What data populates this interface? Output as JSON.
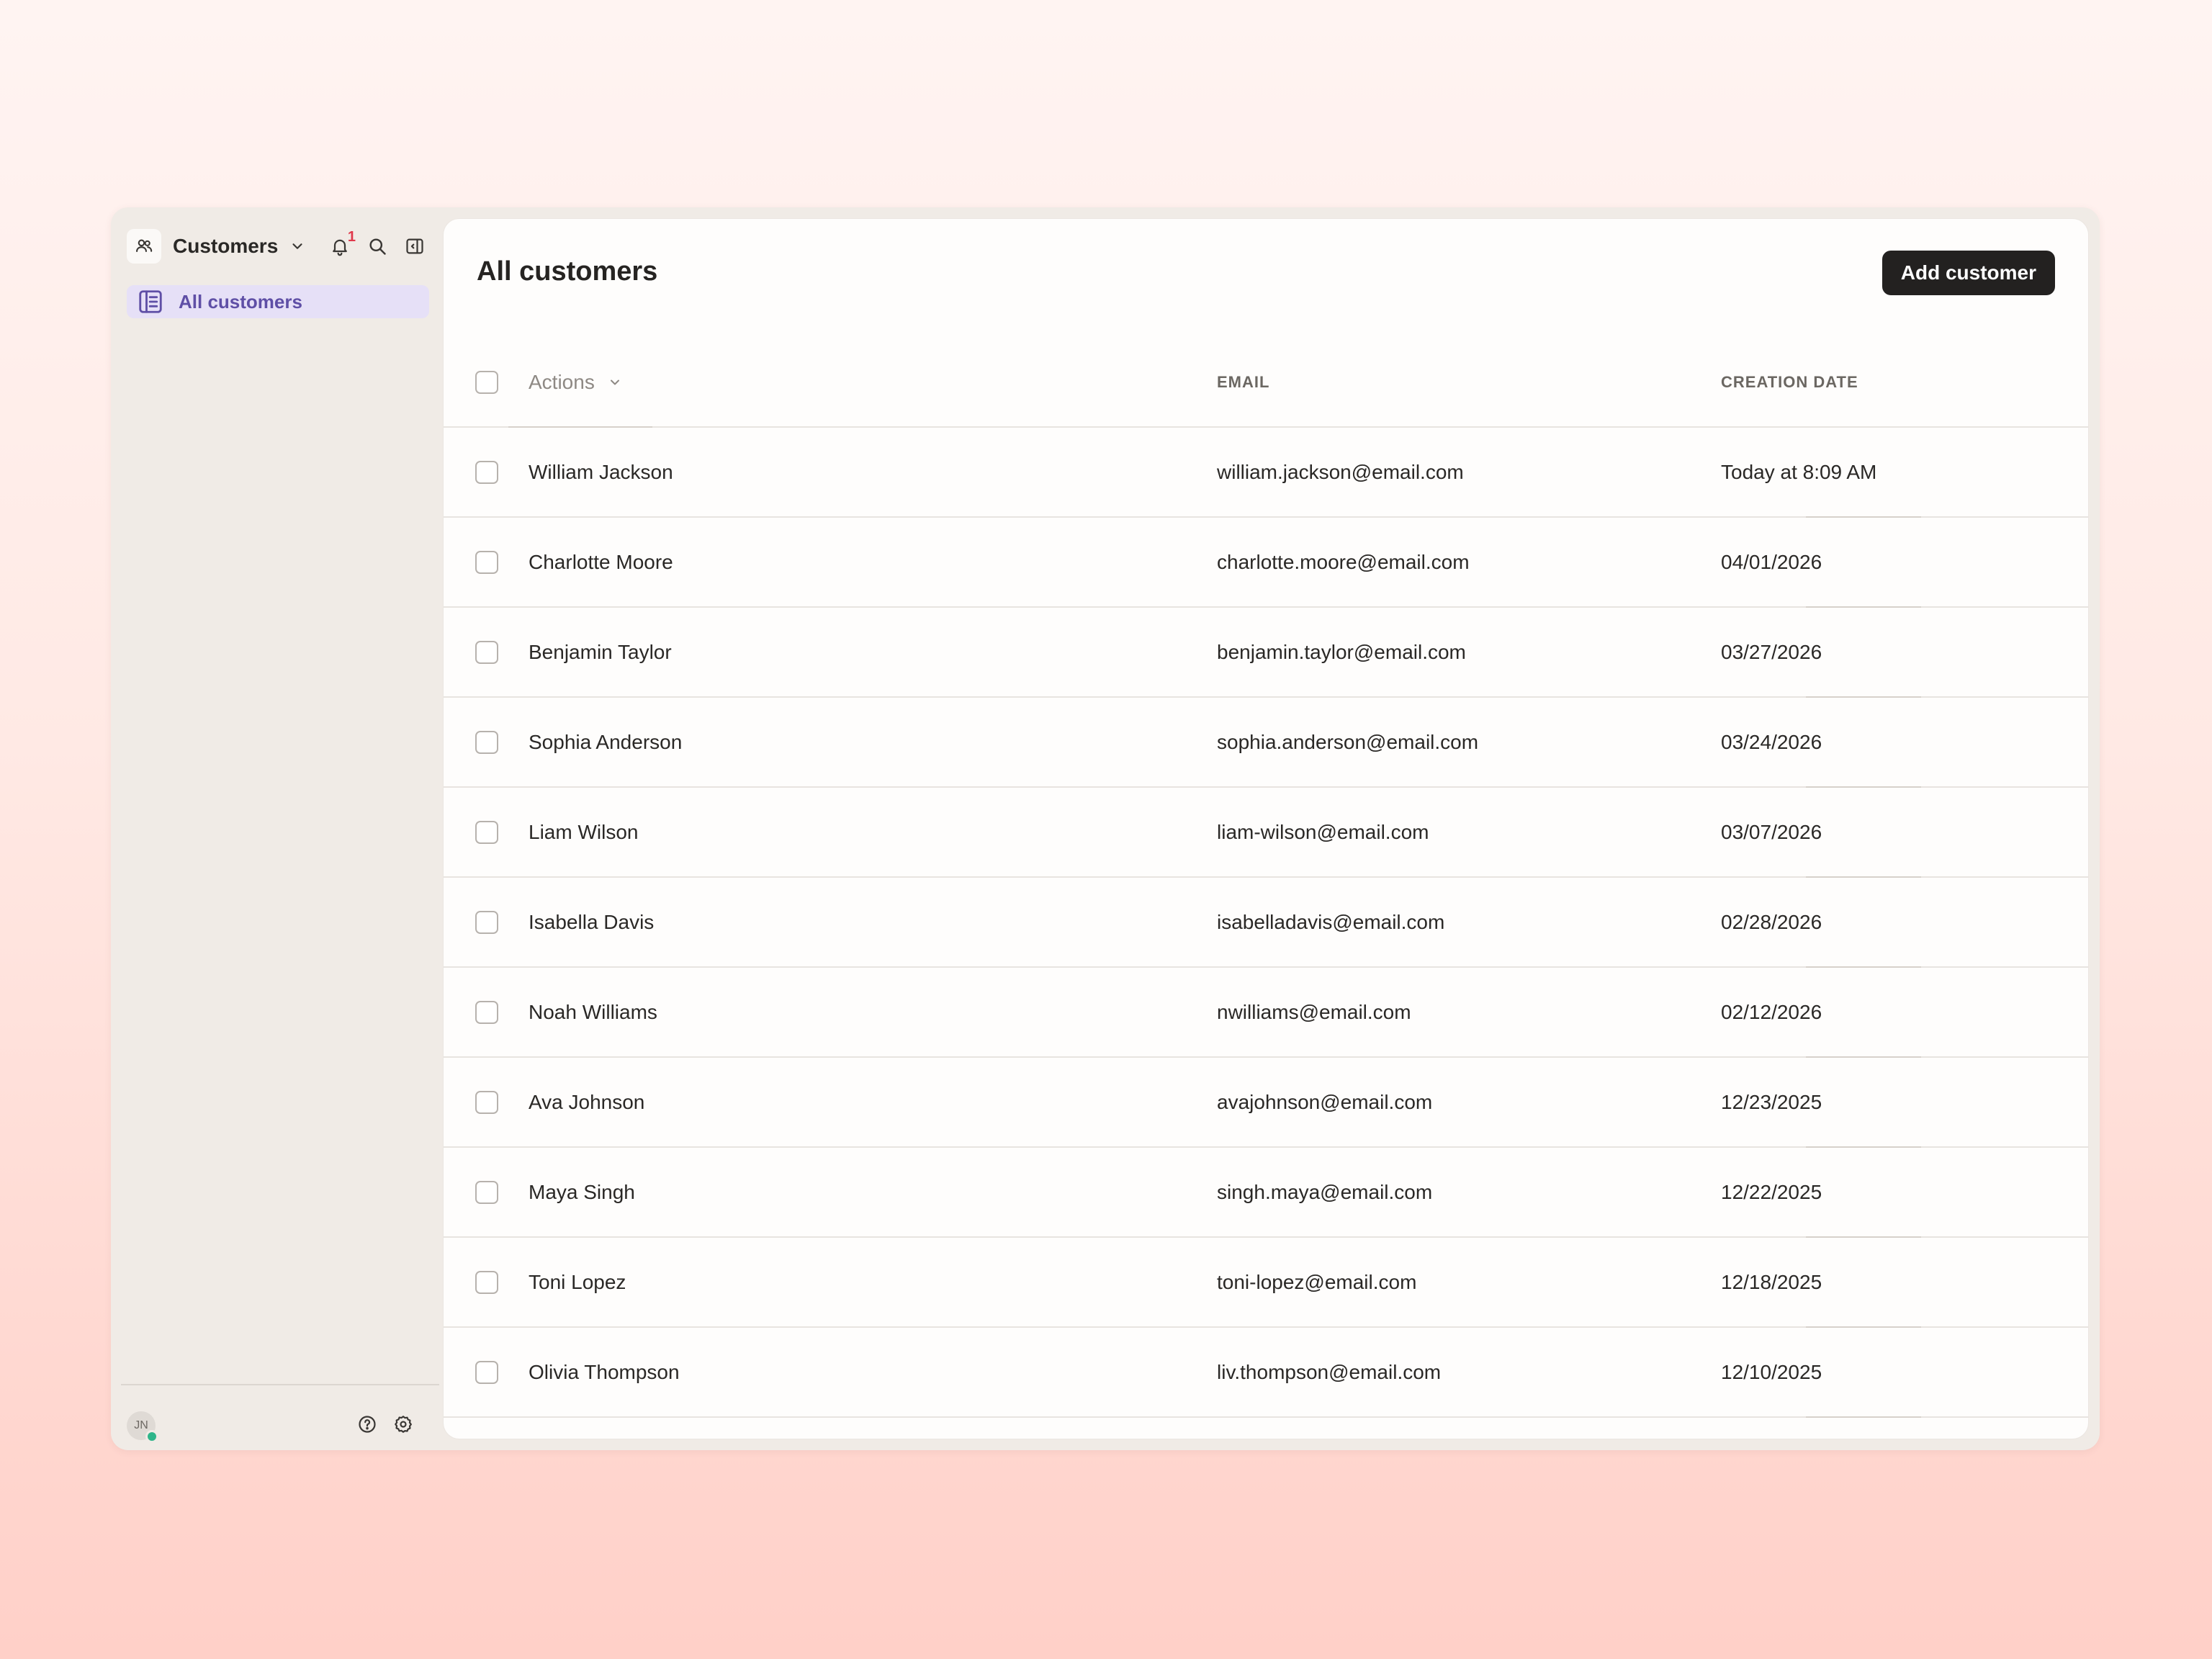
{
  "sidebar": {
    "workspace": "Customers",
    "notification_count": "1",
    "nav": [
      {
        "label": "All customers"
      }
    ],
    "user_initials": "JN"
  },
  "main": {
    "title": "All customers",
    "add_button": "Add customer",
    "columns": {
      "actions": "Actions",
      "email": "EMAIL",
      "date": "CREATION DATE"
    },
    "rows": [
      {
        "name": "William Jackson",
        "email": "william.jackson@email.com",
        "date": "Today at 8:09 AM"
      },
      {
        "name": "Charlotte Moore",
        "email": "charlotte.moore@email.com",
        "date": "04/01/2026"
      },
      {
        "name": "Benjamin Taylor",
        "email": "benjamin.taylor@email.com",
        "date": "03/27/2026"
      },
      {
        "name": "Sophia Anderson",
        "email": "sophia.anderson@email.com",
        "date": "03/24/2026"
      },
      {
        "name": "Liam Wilson",
        "email": "liam-wilson@email.com",
        "date": "03/07/2026"
      },
      {
        "name": "Isabella Davis",
        "email": "isabelladavis@email.com",
        "date": "02/28/2026"
      },
      {
        "name": "Noah Williams",
        "email": "nwilliams@email.com",
        "date": "02/12/2026"
      },
      {
        "name": "Ava Johnson",
        "email": "avajohnson@email.com",
        "date": "12/23/2025"
      },
      {
        "name": "Maya Singh",
        "email": "singh.maya@email.com",
        "date": "12/22/2025"
      },
      {
        "name": "Toni Lopez",
        "email": "toni-lopez@email.com",
        "date": "12/18/2025"
      },
      {
        "name": "Olivia Thompson",
        "email": "liv.thompson@email.com",
        "date": "12/10/2025"
      }
    ]
  },
  "colors": {
    "accent": "#5f4fa6",
    "nav_active_bg": "#e6e0f7",
    "primary_button": "#232120",
    "badge": "#e0384b",
    "presence": "#2fb58a"
  },
  "icons": [
    "users-icon",
    "chevron-down-icon",
    "bell-icon",
    "search-icon",
    "sidebar-toggle-icon",
    "list-icon",
    "help-icon",
    "gear-icon"
  ]
}
